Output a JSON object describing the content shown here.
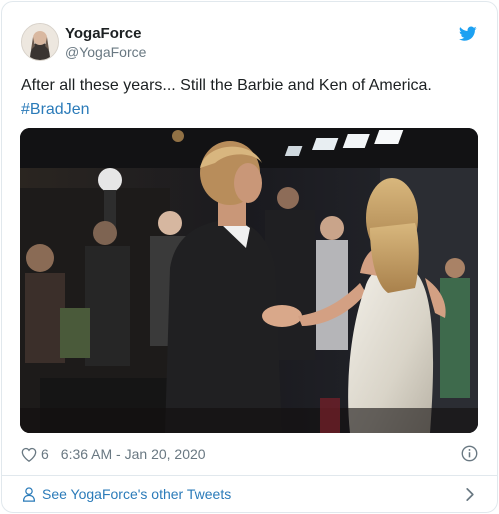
{
  "tweet": {
    "display_name": "YogaForce",
    "handle": "@YogaForce",
    "text_main": "After all these years... Still the Barbie and Ken of America.",
    "hashtag": "#BradJen",
    "like_count": "6",
    "timestamp": "6:36 AM - Jan 20, 2020"
  },
  "footer": {
    "link_text": "See YogaForce's other Tweets"
  },
  "icons": {
    "brand": "twitter-bird-icon",
    "like": "heart-icon",
    "info": "info-icon",
    "profile": "profile-icon",
    "chevron": "chevron-right-icon"
  },
  "colors": {
    "link": "#2b7bb9",
    "muted": "#697882",
    "twitter_blue": "#1da1f2",
    "border": "#e1e8ed"
  }
}
